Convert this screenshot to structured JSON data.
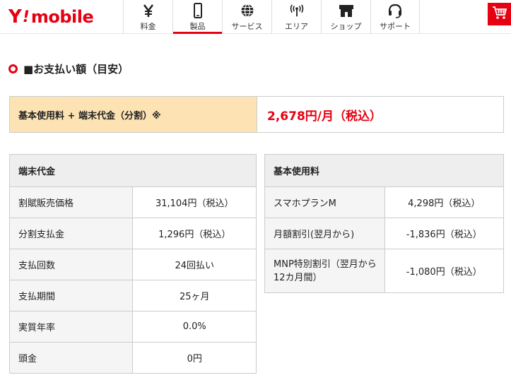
{
  "header": {
    "logo": {
      "y": "Y",
      "slash": "!",
      "mobile": "mobile"
    },
    "nav": [
      {
        "label": "料金",
        "icon": "yen-icon"
      },
      {
        "label": "製品",
        "icon": "smartphone-icon",
        "active": true
      },
      {
        "label": "サービス",
        "icon": "globe-icon"
      },
      {
        "label": "エリア",
        "icon": "signal-icon"
      },
      {
        "label": "ショップ",
        "icon": "shop-icon"
      },
      {
        "label": "サポート",
        "icon": "headset-icon"
      }
    ],
    "cart_icon": "cart-icon"
  },
  "section": {
    "title": "■お支払い額（目安）"
  },
  "total": {
    "label": "基本使用料 + 端末代金（分割）※",
    "value": "2,678円/月（税込）"
  },
  "device": {
    "header": "端末代金",
    "rows": [
      {
        "label": "割賦販売価格",
        "value": "31,104円（税込）"
      },
      {
        "label": "分割支払金",
        "value": "1,296円（税込）"
      },
      {
        "label": "支払回数",
        "value": "24回払い"
      },
      {
        "label": "支払期間",
        "value": "25ヶ月"
      },
      {
        "label": "実質年率",
        "value": "0.0%"
      },
      {
        "label": "頭金",
        "value": "0円"
      }
    ]
  },
  "plan": {
    "header": "基本使用料",
    "rows": [
      {
        "label": "スマホプランM",
        "value": "4,298円（税込）"
      },
      {
        "label": "月額割引(翌月から)",
        "value": "-1,836円（税込）"
      },
      {
        "label": "MNP特別割引（翌月から12カ月間）",
        "value": "-1,080円（税込）"
      }
    ]
  },
  "colors": {
    "accent": "#e60012",
    "total_bg": "#fde3b4",
    "header_bg": "#eeeeee",
    "label_bg": "#f5f5f5"
  }
}
